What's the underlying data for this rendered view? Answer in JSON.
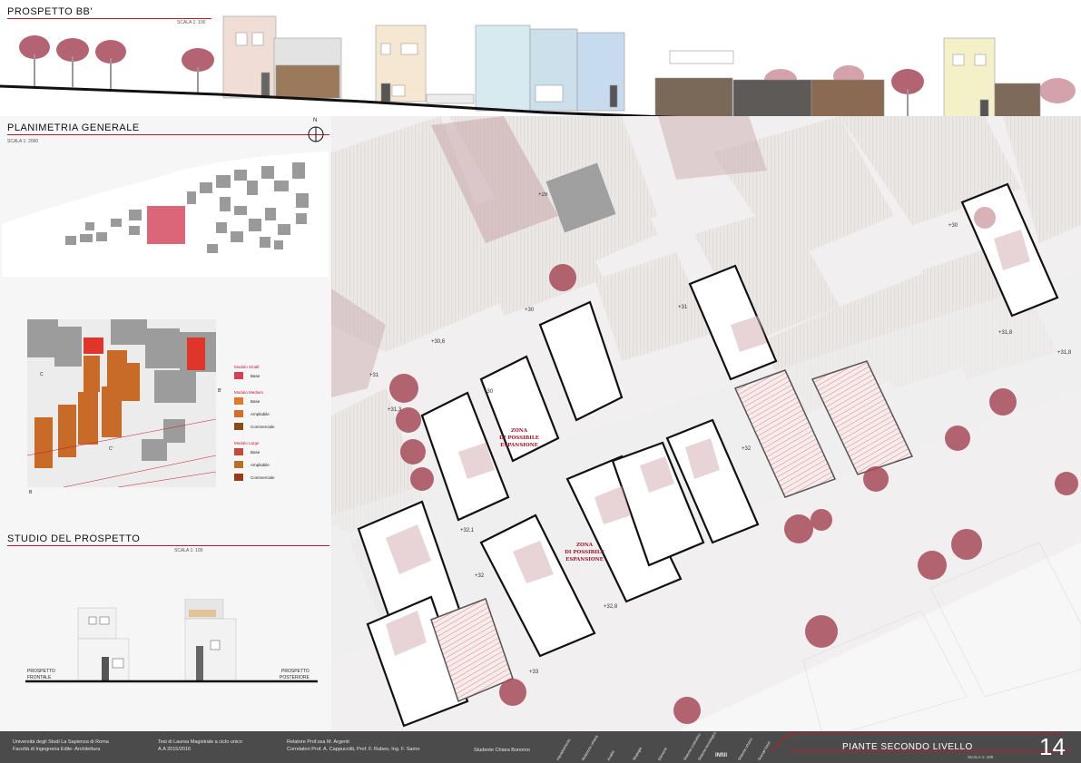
{
  "prospetto": {
    "title": "PROSPETTO BB'",
    "scale": "SCALA 1: 100"
  },
  "planimetria": {
    "title": "PLANIMETRIA GENERALE",
    "scale": "SCALA 1: 2000",
    "north": "N"
  },
  "legend": {
    "groups": [
      {
        "title": "Modulo Small",
        "items": [
          "Base"
        ]
      },
      {
        "title": "Modulo Medium",
        "items": [
          "Base",
          "Ampliabile",
          "Commerciale"
        ]
      },
      {
        "title": "Modulo Large",
        "items": [
          "Base",
          "Ampliabile",
          "Commerciale"
        ]
      }
    ],
    "colors": {
      "accent": "#c8142f",
      "small": "#d4425a",
      "medium": "#e07a2a",
      "large": "#c24a1a"
    }
  },
  "section_marks": [
    "C",
    "C'",
    "B",
    "B'"
  ],
  "studio": {
    "title": "STUDIO DEL PROSPETTO",
    "scale": "SCALA 1: 100",
    "label_front": [
      "PROSPETTO",
      "FRONTALE"
    ],
    "label_back": [
      "PROSPETTO",
      "POSTERIORE"
    ]
  },
  "plan": {
    "levels": [
      "+29",
      "+30",
      "+30",
      "+30",
      "+30,6",
      "+31",
      "+31",
      "+31,3",
      "+31,8",
      "+31,8",
      "+32",
      "+32",
      "+32,1",
      "+32,8",
      "+33"
    ],
    "zona_line1": "ZONA",
    "zona_line2": "DI POSSIBILE",
    "zona_line3": "ESPANSIONE"
  },
  "footer": {
    "univ_line1": "Università degli Studi La Sapienza di Roma",
    "univ_line2": "Facoltà di Ingegneria Edile- Architettura",
    "thesis_line1": "Tesi di Laurea Magistrale a ciclo unico",
    "thesis_line2": "A.A 2015/2016",
    "relatore": "Relatore Prof.ssa M. Argenti",
    "correlatori": "Correlatori Prof. A. Cappuccitti, Prof. F. Rubeo, Ing. F. Sarno",
    "studente": "Studente Chiara Bonomo",
    "phases": [
      "Inquadramento",
      "Relazione urbana",
      "Analisi",
      "Strategia",
      "Elementi",
      "Sistema costruttivo",
      "Sistema tecnologico",
      "INfill",
      "Sistema urbano",
      "Scenari futuri"
    ],
    "sheet_title": "PIANTE SECONDO LIVELLO",
    "sheet_scale": "SCALA 1: 100",
    "sheet_number": "14"
  }
}
